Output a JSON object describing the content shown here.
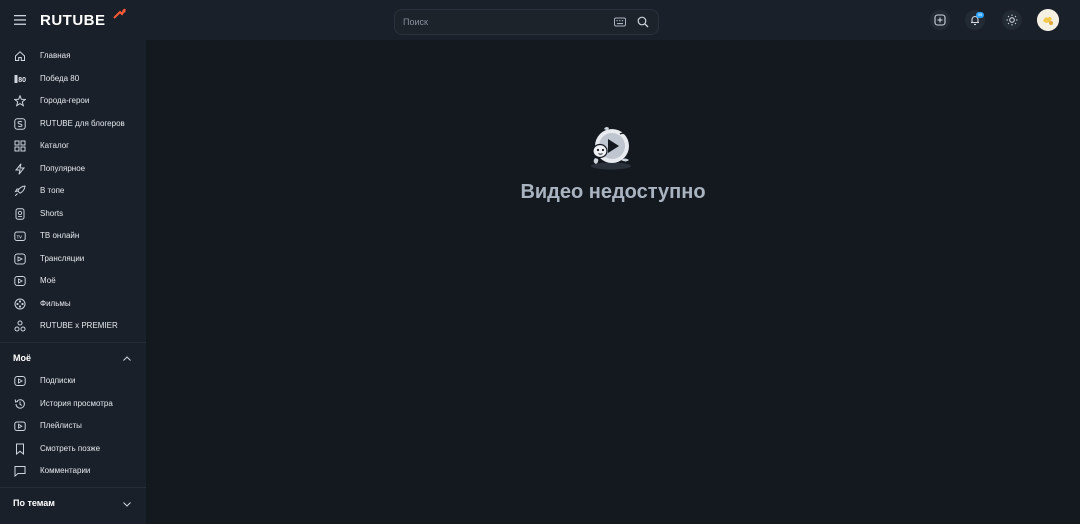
{
  "header": {
    "logo_text": "RUTUBE",
    "search_placeholder": "Поиск",
    "notifications_count": "99"
  },
  "sidebar": {
    "items": [
      {
        "label": "Главная",
        "icon": "home-icon"
      },
      {
        "label": "Победа 80",
        "icon": "victory-icon"
      },
      {
        "label": "Города-герои",
        "icon": "star-icon"
      },
      {
        "label": "RUTUBE для блогеров",
        "icon": "blogger-icon"
      },
      {
        "label": "Каталог",
        "icon": "grid-icon"
      },
      {
        "label": "Популярное",
        "icon": "lightning-icon"
      },
      {
        "label": "В топе",
        "icon": "rocket-icon"
      },
      {
        "label": "Shorts",
        "icon": "shorts-icon"
      },
      {
        "label": "ТВ онлайн",
        "icon": "tv-icon"
      },
      {
        "label": "Трансляции",
        "icon": "broadcast-icon"
      },
      {
        "label": "Моё",
        "icon": "my-icon"
      },
      {
        "label": "Фильмы",
        "icon": "film-icon"
      },
      {
        "label": "RUTUBE x PREMIER",
        "icon": "premier-icon"
      }
    ],
    "my_section": {
      "title": "Моё",
      "items": [
        {
          "label": "Подписки",
          "icon": "subscriptions-icon"
        },
        {
          "label": "История просмотра",
          "icon": "history-icon"
        },
        {
          "label": "Плейлисты",
          "icon": "playlist-icon"
        },
        {
          "label": "Смотреть позже",
          "icon": "bookmark-icon"
        },
        {
          "label": "Комментарии",
          "icon": "comment-icon"
        }
      ]
    },
    "topics_section": {
      "title": "По темам"
    }
  },
  "main": {
    "message": "Видео недоступно"
  },
  "colors": {
    "background": "#14191f",
    "panel": "#1a2029",
    "accent": "#ff5a36"
  }
}
